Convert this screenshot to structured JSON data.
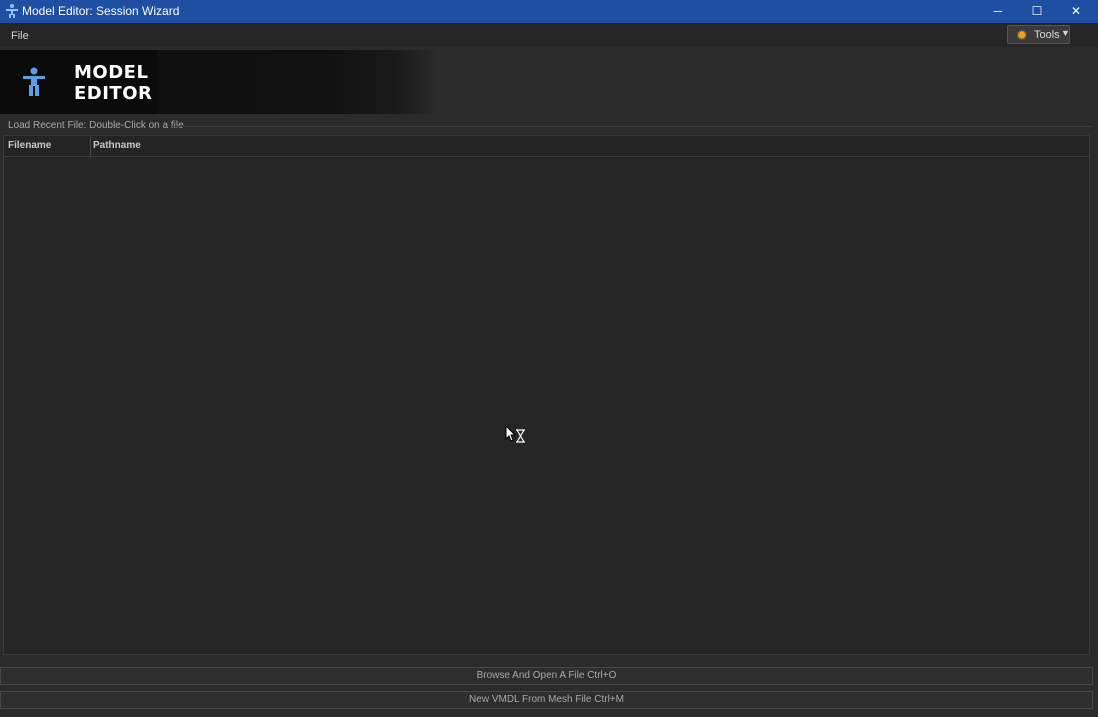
{
  "window": {
    "title": "Model Editor: Session Wizard",
    "controls": {
      "minimize": "─",
      "maximize": "☐",
      "close": "✕"
    }
  },
  "menubar": {
    "file_label": "File",
    "tools_label": "Tools",
    "tools_icon": "gear-icon"
  },
  "banner": {
    "logo_line1": "MODEL",
    "logo_line2": "EDITOR",
    "logo_icon": "figure-icon"
  },
  "recent_files": {
    "group_label": "Load Recent File: Double-Click on a file",
    "columns": [
      "Filename",
      "Pathname"
    ],
    "rows": []
  },
  "actions": {
    "browse_label": "Browse And Open A File Ctrl+O",
    "new_vmdl_label": "New VMDL From Mesh File Ctrl+M"
  },
  "colors": {
    "titlebar": "#1f4fa3",
    "background": "#2b2b2b",
    "accent_gear": "#f0a020",
    "logo_figure": "#5aa0e6"
  }
}
